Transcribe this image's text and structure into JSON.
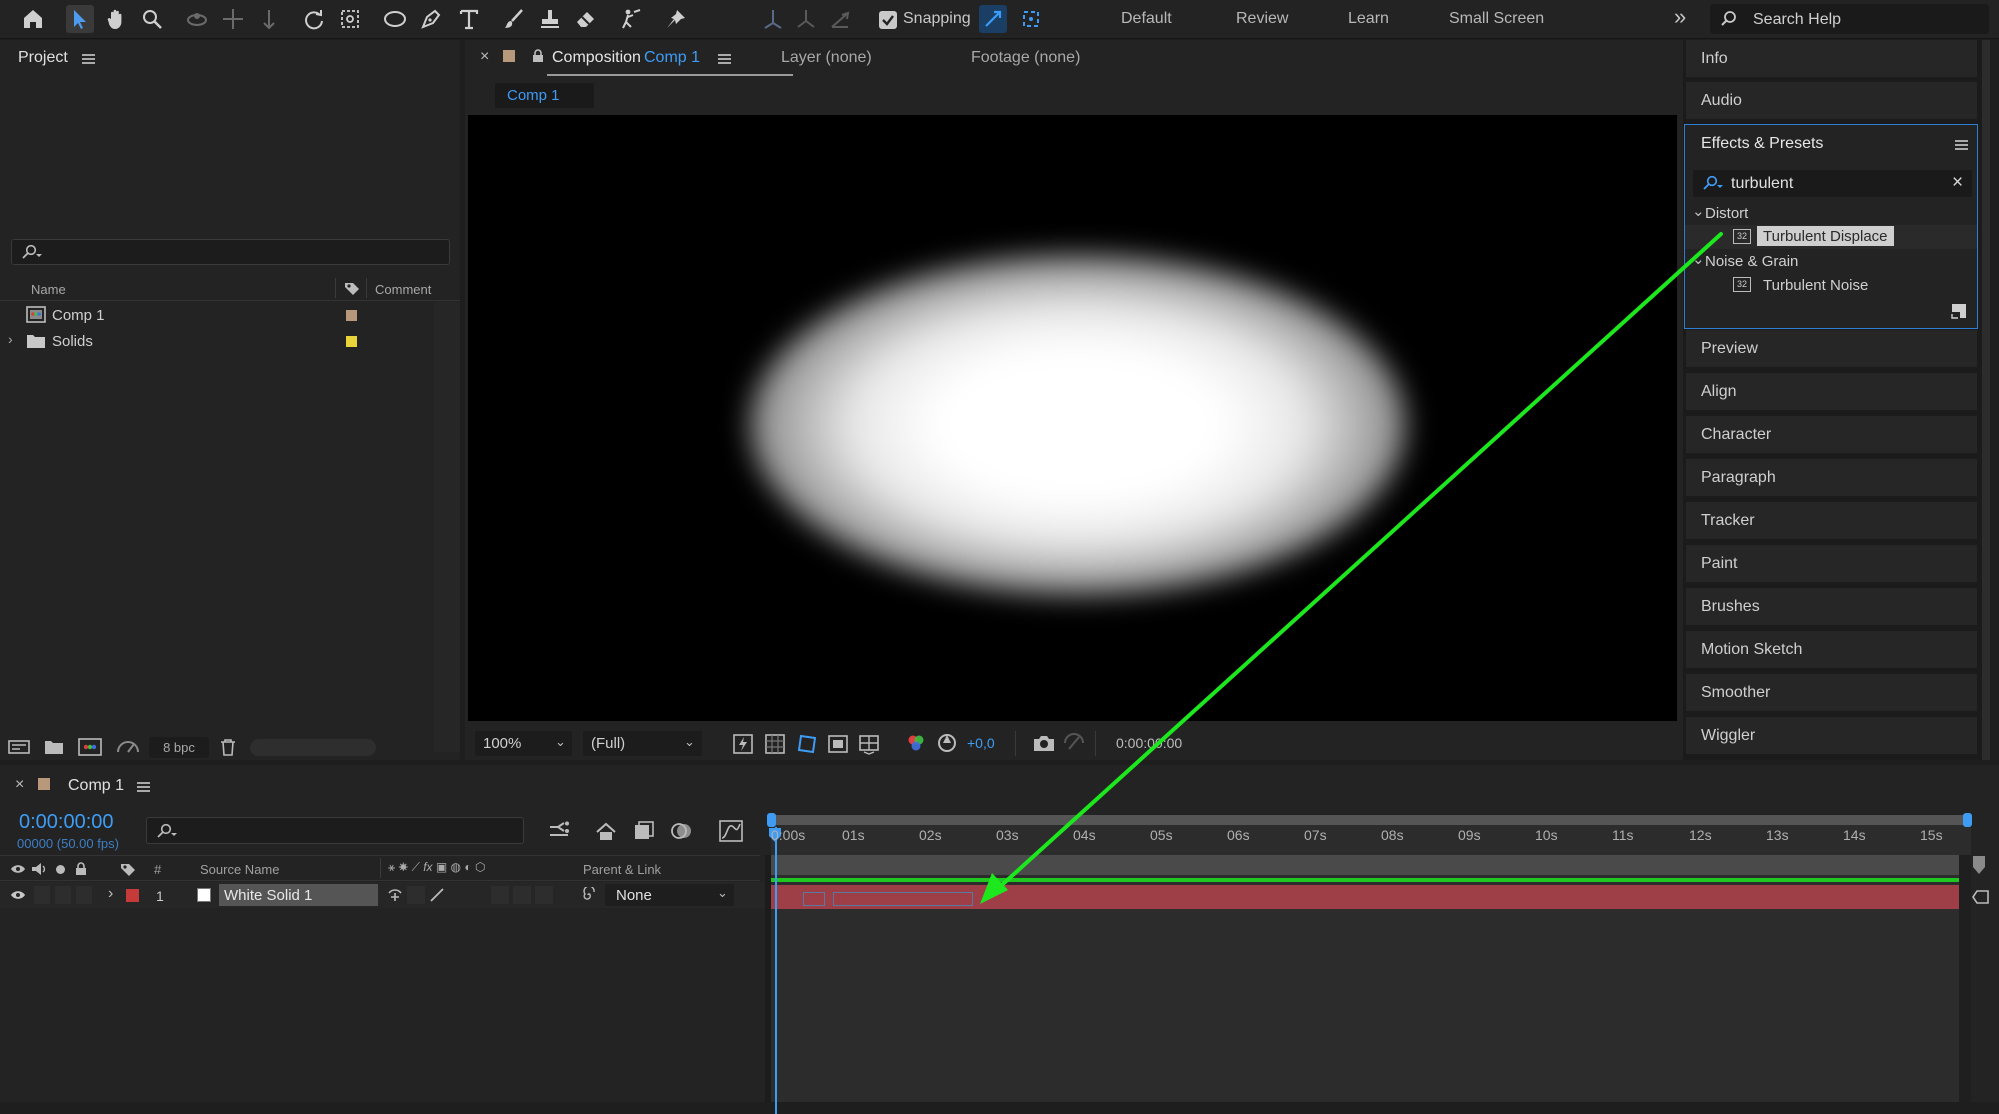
{
  "toolbar": {
    "snapping_label": "Snapping",
    "workspaces": [
      "Default",
      "Review",
      "Learn",
      "Small Screen"
    ],
    "more": "»",
    "search_placeholder": "Search Help"
  },
  "project": {
    "title": "Project",
    "columns": {
      "name": "Name",
      "comment": "Comment"
    },
    "items": [
      {
        "name": "Comp 1",
        "type": "composition",
        "label_color": "#b8987a"
      },
      {
        "name": "Solids",
        "type": "folder",
        "label_color": "#e8d33a"
      }
    ],
    "bpc": "8 bpc"
  },
  "viewer": {
    "tabs": {
      "composition_prefix": "Composition",
      "composition_name": "Comp 1",
      "layer": "Layer (none)",
      "footage": "Footage (none)"
    },
    "breadcrumb": "Comp 1",
    "zoom": "100%",
    "resolution": "(Full)",
    "exposure": "+0,0",
    "timecode": "0:00:00:00"
  },
  "right_panels": {
    "top": [
      "Info",
      "Audio"
    ],
    "effects": {
      "title": "Effects & Presets",
      "search_value": "turbulent",
      "groups": [
        {
          "name": "Distort",
          "items": [
            "Turbulent Displace"
          ]
        },
        {
          "name": "Noise & Grain",
          "items": [
            "Turbulent Noise"
          ]
        }
      ],
      "selected": "Turbulent Displace",
      "badge": "32"
    },
    "bottom": [
      "Preview",
      "Align",
      "Character",
      "Paragraph",
      "Tracker",
      "Paint",
      "Brushes",
      "Motion Sketch",
      "Smoother",
      "Wiggler"
    ]
  },
  "timeline": {
    "tab": "Comp 1",
    "timecode": "0:00:00:00",
    "frame_info": "00000 (50.00 fps)",
    "columns": {
      "num": "#",
      "source": "Source Name",
      "parent": "Parent & Link"
    },
    "ruler": [
      "0:00s",
      "01s",
      "02s",
      "03s",
      "04s",
      "05s",
      "06s",
      "07s",
      "08s",
      "09s",
      "10s",
      "11s",
      "12s",
      "13s",
      "14s",
      "15s"
    ],
    "layers": [
      {
        "num": "1",
        "name": "White Solid 1",
        "parent": "None",
        "label_color": "#c73a3a"
      }
    ]
  },
  "colors": {
    "accent": "#2d8ceb",
    "annotation_arrow": "#1de81d",
    "layer_bar": "#9e3f48"
  }
}
